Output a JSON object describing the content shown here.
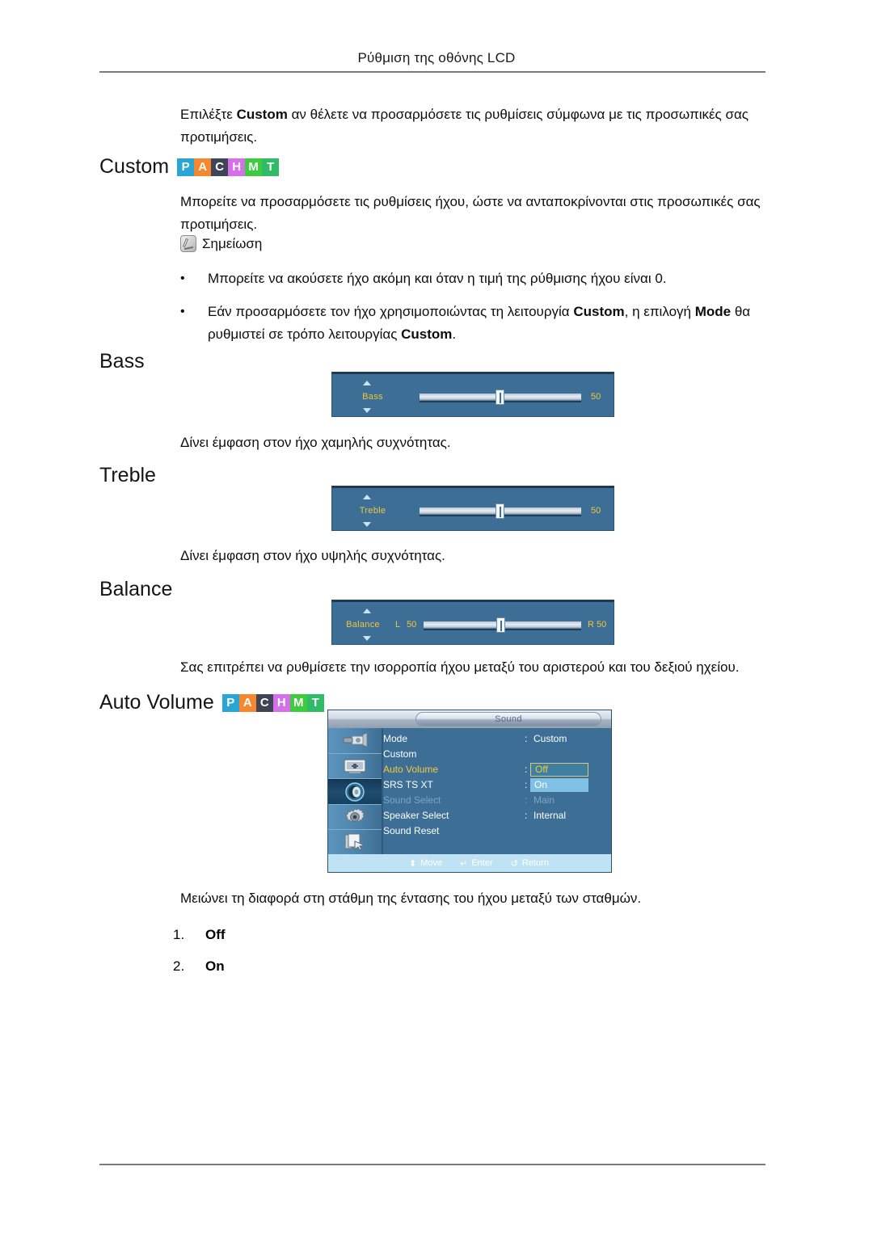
{
  "header": {
    "running_title": "Ρύθμιση της οθόνης LCD"
  },
  "intro": {
    "line1_pre": "Επιλέξτε ",
    "line1_bold": "Custom",
    "line1_post": " αν θέλετε να προσαρμόσετε τις ρυθμίσεις σύμφωνα με τις προσωπικές",
    "line2": "σας προτιμήσεις."
  },
  "sections": {
    "custom": {
      "heading": "Custom",
      "body_line1": "Μπορείτε να προσαρμόσετε τις ρυθμίσεις ήχου, ώστε να ανταποκρίνονται στις προσωπικές",
      "body_line2": "σας προτιμήσεις."
    },
    "bass": {
      "heading": "Bass",
      "description": "Δίνει έμφαση στον ήχο χαμηλής συχνότητας."
    },
    "treble": {
      "heading": "Treble",
      "description": "Δίνει έμφαση στον ήχο υψηλής συχνότητας."
    },
    "balance": {
      "heading": "Balance",
      "description": "Σας επιτρέπει να ρυθμίσετε την ισορροπία ήχου μεταξύ του αριστερού και του δεξιού ηχείου."
    },
    "auto_volume": {
      "heading": "Auto Volume",
      "description": "Μειώνει τη διαφορά στη στάθμη της έντασης του ήχου μεταξύ των σταθμών.",
      "options": [
        {
          "num": "1.",
          "label": "Off"
        },
        {
          "num": "2.",
          "label": "On"
        }
      ]
    }
  },
  "note": {
    "icon": "note-pen-icon",
    "label": "Σημείωση",
    "bullets": [
      {
        "marker": "•",
        "text": "Μπορείτε να ακούσετε ήχο ακόμη και όταν η τιμή της ρύθμισης ήχου είναι 0."
      },
      {
        "marker": "•",
        "line1_pre": "Εάν προσαρμόσετε τον ήχο χρησιμοποιώντας τη λειτουργία ",
        "line1_b1": "Custom",
        "line1_mid": ", η επιλογή ",
        "line1_b2": "Mode",
        "line1_post": " θα",
        "line2_pre": "ρυθμιστεί σε τρόπο λειτουργίας ",
        "line2_b1": "Custom",
        "line2_post": "."
      }
    ]
  },
  "badges": {
    "items": [
      {
        "letter": "P",
        "color": "#29a6d6"
      },
      {
        "letter": "A",
        "color": "#f5872f"
      },
      {
        "letter": "C",
        "color": "#3f4556"
      },
      {
        "letter": "H",
        "color": "#d670ea"
      },
      {
        "letter": "M",
        "color": "#3ecb3e"
      },
      {
        "letter": "T",
        "color": "#30bb66"
      }
    ]
  },
  "osd_sliders": {
    "bass": {
      "label": "Bass",
      "value": "50"
    },
    "treble": {
      "label": "Treble",
      "value": "50"
    },
    "balance": {
      "label": "Balance",
      "left_prefix": "L",
      "left_value": "50",
      "right_value": "R  50"
    }
  },
  "osd_menu": {
    "title": "Sound",
    "icons": [
      "input-source-icon",
      "picture-icon",
      "sound-speaker-icon",
      "setup-gear-icon",
      "multi-control-icon"
    ],
    "rows": [
      {
        "key": "Mode",
        "sep": ":",
        "value": "Custom",
        "state": "normal"
      },
      {
        "key": "Custom",
        "sep": "",
        "value": "",
        "state": "normal"
      },
      {
        "key": "Auto Volume",
        "sep": ":",
        "value": "Off",
        "state": "amber-selected"
      },
      {
        "key": "SRS TS XT",
        "sep": ":",
        "value": "On",
        "state": "highlight"
      },
      {
        "key": "Sound Select",
        "sep": ":",
        "value": "Main",
        "state": "dim"
      },
      {
        "key": "Speaker Select",
        "sep": ":",
        "value": "Internal",
        "state": "normal"
      },
      {
        "key": "Sound Reset",
        "sep": "",
        "value": "",
        "state": "normal"
      }
    ],
    "hints": [
      {
        "glyph": "⬍",
        "label": "Move"
      },
      {
        "glyph": "↵",
        "label": "Enter"
      },
      {
        "glyph": "↺",
        "label": "Return"
      }
    ]
  }
}
